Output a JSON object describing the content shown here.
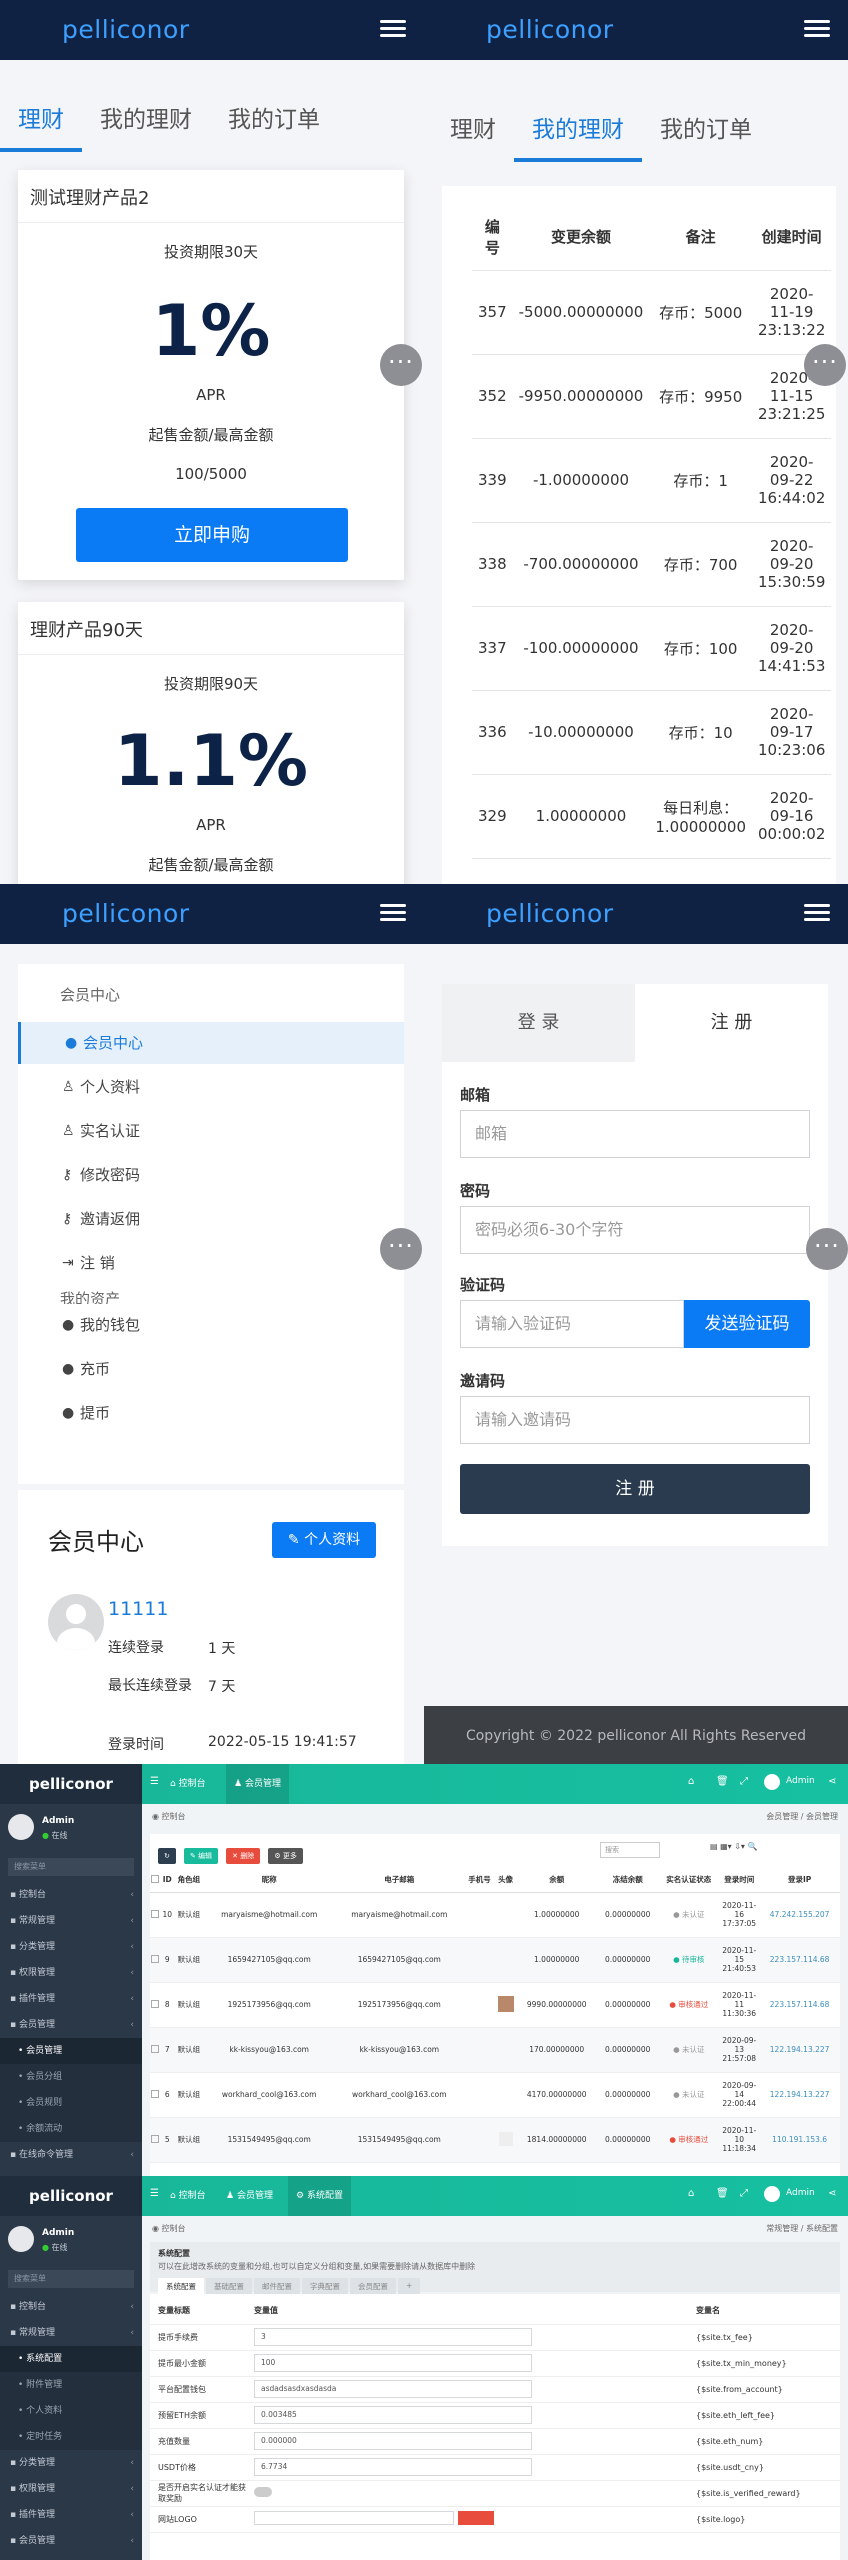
{
  "site": {
    "logo": "pelliconor"
  },
  "wealth": {
    "tabs": [
      "理财",
      "我的理财",
      "我的订单"
    ],
    "products": [
      {
        "title": "测试理财产品2",
        "period": "投资期限30天",
        "rate": "1%",
        "apr": "APR",
        "range_label": "起售金额/最高金额",
        "range": "100/5000",
        "button": "立即申购"
      },
      {
        "title": "理财产品90天",
        "period": "投资期限90天",
        "rate": "1.1%",
        "apr": "APR",
        "range_label": "起售金额/最高金额"
      }
    ]
  },
  "my_wealth": {
    "tabs": [
      "理财",
      "我的理财",
      "我的订单"
    ],
    "headers": [
      "编号",
      "变更余额",
      "备注",
      "创建时间"
    ],
    "rows": [
      {
        "id": "357",
        "amount": "-5000.00000000",
        "note": "存币：5000",
        "time": "2020-11-19 23:13:22"
      },
      {
        "id": "352",
        "amount": "-9950.00000000",
        "note": "存币：9950",
        "time": "2020-11-15 23:21:25"
      },
      {
        "id": "339",
        "amount": "-1.00000000",
        "note": "存币：1",
        "time": "2020-09-22 16:44:02"
      },
      {
        "id": "338",
        "amount": "-700.00000000",
        "note": "存币：700",
        "time": "2020-09-20 15:30:59"
      },
      {
        "id": "337",
        "amount": "-100.00000000",
        "note": "存币：100",
        "time": "2020-09-20 14:41:53"
      },
      {
        "id": "336",
        "amount": "-10.00000000",
        "note": "存币：10",
        "time": "2020-09-17 10:23:06"
      },
      {
        "id": "329",
        "amount": "1.00000000",
        "note": "每日利息：1.00000000",
        "time": "2020-09-16 00:00:02"
      }
    ]
  },
  "member": {
    "section1": "会员中心",
    "menu": [
      "会员中心",
      "个人资料",
      "实名认证",
      "修改密码",
      "邀请返佣",
      "注 销"
    ],
    "section2": "我的资产",
    "assets": [
      "我的钱包",
      "充币",
      "提币"
    ],
    "card_title": "会员中心",
    "profile_button": "个人资料",
    "username": "11111",
    "fields": [
      {
        "k": "连续登录",
        "v": "1 天"
      },
      {
        "k": "最长连续登录",
        "v": "7 天"
      },
      {
        "k": "登录时间",
        "v": "2022-05-15 19:41:57"
      }
    ]
  },
  "auth": {
    "tab_login": "登 录",
    "tab_register": "注 册",
    "email_label": "邮箱",
    "email_ph": "邮箱",
    "pwd_label": "密码",
    "pwd_ph": "密码必须6-30个字符",
    "code_label": "验证码",
    "code_ph": "请输入验证码",
    "send_code": "发送验证码",
    "invite_label": "邀请码",
    "invite_ph": "请输入邀请码",
    "submit": "注 册",
    "copyright": "Copyright © 2022 pelliconor All Rights Reserved"
  },
  "admin1": {
    "brand": "pelliconor",
    "tabs": [
      "控制台",
      "会员管理"
    ],
    "user": "Admin",
    "online": "在线",
    "search_ph": "搜索菜单",
    "breadcrumb_left": "控制台",
    "breadcrumb_right": [
      "会员管理",
      "会员管理"
    ],
    "menu": [
      {
        "label": "控制台"
      },
      {
        "label": "常规管理"
      },
      {
        "label": "分类管理"
      },
      {
        "label": "权限管理"
      },
      {
        "label": "插件管理"
      },
      {
        "label": "会员管理"
      },
      {
        "label": "会员管理",
        "sub": true,
        "on": true
      },
      {
        "label": "会员分组",
        "sub": true
      },
      {
        "label": "会员规则",
        "sub": true
      },
      {
        "label": "余额流动",
        "sub": true
      },
      {
        "label": "在线命令管理"
      }
    ],
    "toolbar": [
      "编辑",
      "删除",
      "更多"
    ],
    "search_ph2": "搜索",
    "headers": [
      "",
      "ID",
      "角色组",
      "昵称",
      "电子邮箱",
      "手机号",
      "头像",
      "余额",
      "冻结余额",
      "实名认证状态",
      "登录时间",
      "登录IP"
    ],
    "rows": [
      {
        "id": "10",
        "group": "默认组",
        "nick": "maryaisme@hotmail.com",
        "email": "maryaisme@hotmail.com",
        "balance": "1.00000000",
        "frozen": "0.00000000",
        "status": "未认证",
        "sc": "#999",
        "time": "2020-11-16 17:37:05",
        "ip": "47.242.155.207"
      },
      {
        "id": "9",
        "group": "默认组",
        "nick": "1659427105@qq.com",
        "email": "1659427105@qq.com",
        "balance": "1.00000000",
        "frozen": "0.00000000",
        "status": "待审核",
        "sc": "#18b79a",
        "time": "2020-11-15 21:40:53",
        "ip": "223.157.114.68"
      },
      {
        "id": "8",
        "group": "默认组",
        "nick": "1925173956@qq.com",
        "email": "1925173956@qq.com",
        "balance": "9990.00000000",
        "frozen": "0.00000000",
        "status": "审核通过",
        "sc": "#e74c3c",
        "time": "2020-11-11 11:30:36",
        "ip": "223.157.114.68"
      },
      {
        "id": "7",
        "group": "默认组",
        "nick": "kk-kissyou@163.com",
        "email": "kk-kissyou@163.com",
        "balance": "170.00000000",
        "frozen": "0.00000000",
        "status": "未认证",
        "sc": "#999",
        "time": "2020-09-13 21:57:08",
        "ip": "122.194.13.227"
      },
      {
        "id": "6",
        "group": "默认组",
        "nick": "workhard_cool@163.com",
        "email": "workhard_cool@163.com",
        "balance": "4170.00000000",
        "frozen": "0.00000000",
        "status": "未认证",
        "sc": "#999",
        "time": "2020-09-14 22:00:44",
        "ip": "122.194.13.227"
      },
      {
        "id": "5",
        "group": "默认组",
        "nick": "1531549495@qq.com",
        "email": "1531549495@qq.com",
        "balance": "1814.00000000",
        "frozen": "0.00000000",
        "status": "审核通过",
        "sc": "#e74c3c",
        "time": "2020-11-10 11:18:34",
        "ip": "110.191.153.6"
      }
    ]
  },
  "admin2": {
    "brand": "pelliconor",
    "tabs": [
      "控制台",
      "会员管理",
      "系统配置"
    ],
    "user": "Admin",
    "online": "在线",
    "search_ph": "搜索菜单",
    "breadcrumb_left": "控制台",
    "breadcrumb_right": [
      "常规管理",
      "系统配置"
    ],
    "menu": [
      {
        "label": "控制台"
      },
      {
        "label": "常规管理"
      },
      {
        "label": "系统配置",
        "sub": true,
        "on": true
      },
      {
        "label": "附件管理",
        "sub": true
      },
      {
        "label": "个人资料",
        "sub": true
      },
      {
        "label": "定时任务",
        "sub": true
      },
      {
        "label": "分类管理"
      },
      {
        "label": "权限管理"
      },
      {
        "label": "插件管理"
      },
      {
        "label": "会员管理"
      },
      {
        "label": "在线命令管理"
      }
    ],
    "title": "系统配置",
    "desc": "可以在此增改系统的变量和分组,也可以自定义分组和变量,如果需要删除请从数据库中删除",
    "config_tabs": [
      "系统配置",
      "基础配置",
      "邮件配置",
      "字典配置",
      "会员配置",
      "+"
    ],
    "col_titles": [
      "变量标题",
      "变量值",
      "变量名"
    ],
    "rows": [
      {
        "k": "提币手续费",
        "v": "3",
        "n": "{$site.tx_fee}"
      },
      {
        "k": "提币最小金额",
        "v": "100",
        "n": "{$site.tx_min_money}"
      },
      {
        "k": "平台配置钱包",
        "v": "asdadsasdxasdasda",
        "n": "{$site.from_account}"
      },
      {
        "k": "预留ETH余额",
        "v": "0.003485",
        "n": "{$site.eth_left_fee}"
      },
      {
        "k": "充值数量",
        "v": "0.000000",
        "n": "{$site.eth_num}"
      },
      {
        "k": "USDT价格",
        "v": "6.7734",
        "n": "{$site.usdt_cny}"
      },
      {
        "k": "是否开启实名认证才能获取奖励",
        "v": "",
        "n": "{$site.is_verified_reward}"
      },
      {
        "k": "网站LOGO",
        "v": "",
        "n": "{$site.logo}"
      }
    ]
  }
}
